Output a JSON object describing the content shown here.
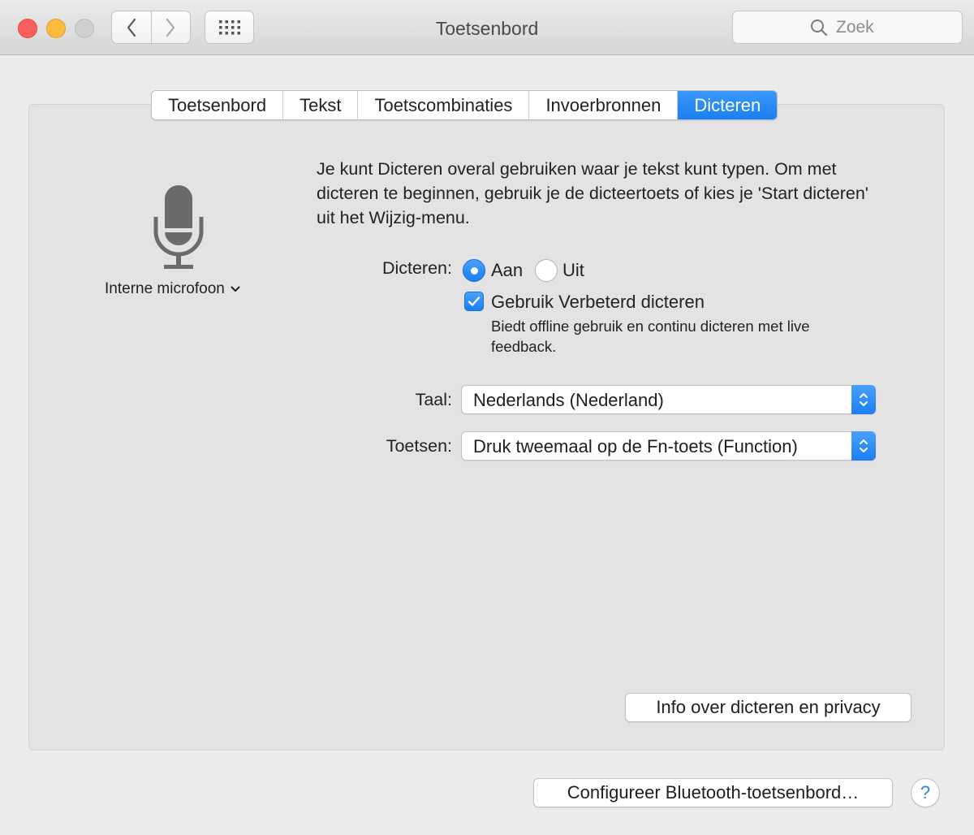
{
  "window": {
    "title": "Toetsenbord",
    "search_placeholder": "Zoek"
  },
  "toolbar": {
    "back_icon": "chevron-left-icon",
    "forward_icon": "chevron-right-icon",
    "grid_icon": "grid-icon",
    "search_icon": "magnifier-icon"
  },
  "tabs": [
    {
      "label": "Toetsenbord",
      "active": false
    },
    {
      "label": "Tekst",
      "active": false
    },
    {
      "label": "Toetscombinaties",
      "active": false
    },
    {
      "label": "Invoerbronnen",
      "active": false
    },
    {
      "label": "Dicteren",
      "active": true
    }
  ],
  "microphone": {
    "icon": "microphone-icon",
    "source_label": "Interne microfoon"
  },
  "dictation": {
    "intro": "Je kunt Dicteren overal gebruiken waar je tekst kunt typen. Om met dicteren te beginnen, gebruik je de dicteertoets of kies je 'Start dicteren' uit het Wijzig-menu.",
    "label": "Dicteren:",
    "option_on": "Aan",
    "option_off": "Uit",
    "selected": "Aan",
    "enhanced_label": "Gebruik Verbeterd dicteren",
    "enhanced_checked": true,
    "enhanced_hint": "Biedt offline gebruik en continu dicteren met live feedback.",
    "language_label": "Taal:",
    "language_value": "Nederlands (Nederland)",
    "shortcut_label": "Toetsen:",
    "shortcut_value": "Druk tweemaal op de Fn-toets (Function)",
    "privacy_button": "Info over dicteren en privacy"
  },
  "footer": {
    "bluetooth_button": "Configureer Bluetooth-toetsenbord…",
    "help_button": "?"
  },
  "colors": {
    "accent": "#1a7ff2",
    "close": "#fc605c",
    "minimize": "#fdbc40",
    "zoom_inactive": "#cfcfcf"
  }
}
